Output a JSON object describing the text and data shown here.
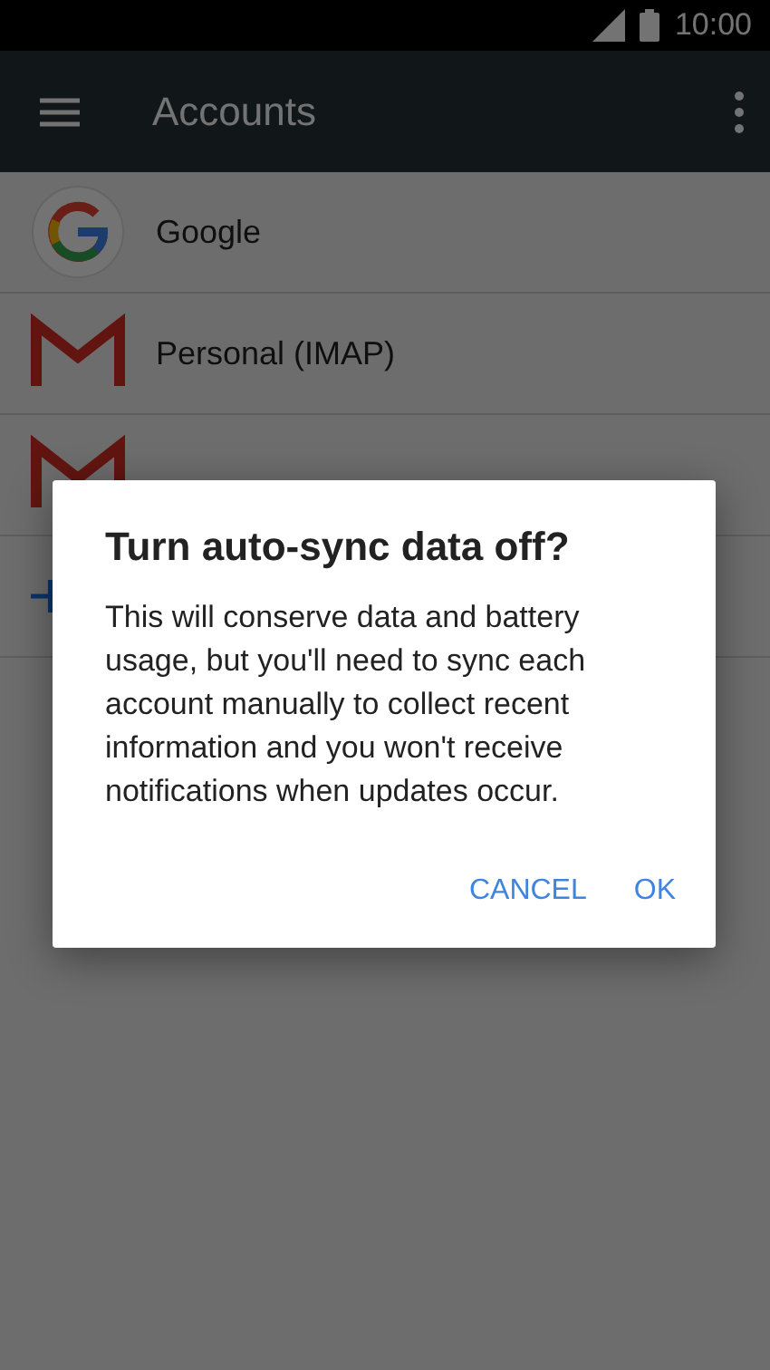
{
  "status_bar": {
    "time": "10:00"
  },
  "app_bar": {
    "title": "Accounts"
  },
  "accounts": [
    {
      "kind": "google",
      "name": "Google"
    },
    {
      "kind": "gmail",
      "name": "Personal (IMAP)"
    },
    {
      "kind": "gmail"
    },
    {
      "kind": "add"
    }
  ],
  "dialog": {
    "title": "Turn auto-sync data off?",
    "message": "This will conserve data and battery usage, but you'll need to sync each account manually to collect recent information and you won't receive notifications when updates occur.",
    "buttons": [
      "CANCEL",
      "OK"
    ]
  }
}
